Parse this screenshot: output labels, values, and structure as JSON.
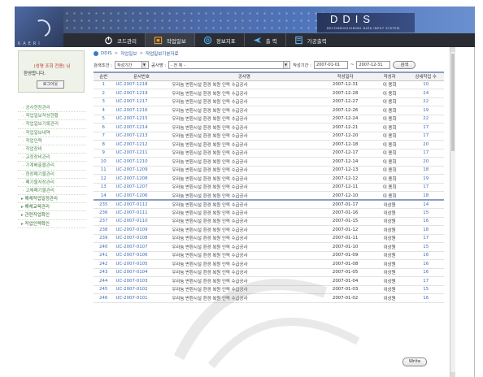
{
  "header": {
    "brand_title": "DDIS",
    "brand_sub": "DECOMMISSIONING DATA INPUT SYSTEM",
    "logo_text": "KAERI",
    "nav": [
      {
        "label": "코드관리",
        "icon": "power-icon"
      },
      {
        "label": "작업일보",
        "icon": "calendar-icon",
        "active": true
      },
      {
        "label": "정보지표",
        "icon": "at-icon"
      },
      {
        "label": "출 력",
        "icon": "plane-icon"
      },
      {
        "label": "가공출력",
        "icon": "document-icon"
      }
    ]
  },
  "left": {
    "greet_line1": "(성명 조회 전용) 님",
    "greet_line2": "환영합니다.",
    "logout_label": "로그아웃",
    "menu": [
      {
        "label": "공사현장관리",
        "type": "sub"
      },
      {
        "label": "작업일보작성현황",
        "type": "sub"
      },
      {
        "label": "작업일보기록관리",
        "type": "sub"
      },
      {
        "label": "작업일보내역",
        "type": "sub"
      },
      {
        "label": "작업인력",
        "type": "sub"
      },
      {
        "label": "작업장비",
        "type": "sub"
      },
      {
        "label": "교정장비관리",
        "type": "sub"
      },
      {
        "label": "기계배출물관리",
        "type": "sub"
      },
      {
        "label": "현장폐기물관리",
        "type": "sub"
      },
      {
        "label": "폐기물저장관리",
        "type": "sub"
      },
      {
        "label": "고체폐기물관리",
        "type": "sub"
      },
      {
        "label": "해체작업일정관리",
        "type": "top"
      },
      {
        "label": "해체교육관리",
        "type": "top"
      },
      {
        "label": "관련작업확인",
        "type": "top"
      },
      {
        "label": "작업인력확인",
        "type": "top"
      }
    ]
  },
  "breadcrumb": [
    "DDIS",
    "작업일보",
    "작업일보기본자료"
  ],
  "search": {
    "cond_label": "검색조건 :",
    "cond_value": "작성기간",
    "proj_label": "공사명 :",
    "proj_value": "- 전 체 -",
    "period_label": "작성기간 :",
    "date_from": "2007-01-01",
    "date_to": "2007-12-31",
    "button": "검색"
  },
  "table": {
    "headers": [
      "순번",
      "문서번호",
      "공사명",
      "작성일자",
      "작성자",
      "상세작업 수"
    ],
    "rows": [
      [
        "1",
        "UC-2007-1218",
        "우라늄 변환시설 환경 복원 인력 수급공사",
        "2007-12-31",
        "이 용희",
        "10"
      ],
      [
        "2",
        "UC-2007-1219",
        "우라늄 변환시설 환경 복원 인력 수급공사",
        "2007-12-28",
        "이 용희",
        "24"
      ],
      [
        "3",
        "UC-2007-1217",
        "우라늄 변환시설 환경 복원 인력 수급공사",
        "2007-12-27",
        "이 용희",
        "22"
      ],
      [
        "4",
        "UC-2007-1216",
        "우라늄 변환시설 환경 복원 인력 수급공사",
        "2007-12-26",
        "이 용희",
        "19"
      ],
      [
        "5",
        "UC-2007-1215",
        "우라늄 변환시설 환경 복원 인력 수급공사",
        "2007-12-24",
        "이 용희",
        "22"
      ],
      [
        "6",
        "UC-2007-1214",
        "우라늄 변환시설 환경 복원 인력 수급공사",
        "2007-12-21",
        "이 용희",
        "17"
      ],
      [
        "7",
        "UC-2007-1213",
        "우라늄 변환시설 환경 복원 인력 수급공사",
        "2007-12-20",
        "이 용희",
        "17"
      ],
      [
        "8",
        "UC-2007-1212",
        "우라늄 변환시설 환경 복원 인력 수급공사",
        "2007-12-18",
        "이 용희",
        "20"
      ],
      [
        "9",
        "UC-2007-1211",
        "우라늄 변환시설 환경 복원 인력 수급공사",
        "2007-12-17",
        "이 용희",
        "17"
      ],
      [
        "10",
        "UC-2007-1210",
        "우라늄 변환시설 환경 복원 인력 수급공사",
        "2007-12-14",
        "이 용희",
        "20"
      ],
      [
        "11",
        "UC-2007-1209",
        "우라늄 변환시설 환경 복원 인력 수급공사",
        "2007-12-13",
        "이 용희",
        "18"
      ],
      [
        "12",
        "UC-2007-1208",
        "우라늄 변환시설 환경 복원 인력 수급공사",
        "2007-12-12",
        "이 용희",
        "19"
      ],
      [
        "13",
        "UC-2007-1207",
        "우라늄 변환시설 환경 복원 인력 수급공사",
        "2007-12-11",
        "이 용희",
        "17"
      ],
      [
        "14",
        "UC-2007-1206",
        "우라늄 변환시설 환경 복원 인력 수급공사",
        "2007-12-10",
        "이 용희",
        "18"
      ]
    ],
    "rows2": [
      [
        "235",
        "UC-2007-0112",
        "우라늄 변환시설 환경 복원 인력 수급공사",
        "2007-01-17",
        "이상원",
        "14"
      ],
      [
        "236",
        "UC-2007-0111",
        "우라늄 변환시설 환경 복원 인력 수급공사",
        "2007-01-16",
        "이상원",
        "15"
      ],
      [
        "237",
        "UC-2007-0110",
        "우라늄 변환시설 환경 복원 인력 수급공사",
        "2007-01-15",
        "이상원",
        "16"
      ],
      [
        "238",
        "UC-2007-0109",
        "우라늄 변환시설 환경 복원 인력 수급공사",
        "2007-01-12",
        "이상원",
        "18"
      ],
      [
        "239",
        "UC-2007-0108",
        "우라늄 변환시설 환경 복원 인력 수급공사",
        "2007-01-11",
        "이상원",
        "17"
      ],
      [
        "240",
        "UC-2007-0107",
        "우라늄 변환시설 환경 복원 인력 수급공사",
        "2007-01-10",
        "이상원",
        "15"
      ],
      [
        "241",
        "UC-2007-0106",
        "우라늄 변환시설 환경 복원 인력 수급공사",
        "2007-01-09",
        "이상원",
        "16"
      ],
      [
        "242",
        "UC-2007-0105",
        "우라늄 변환시설 환경 복원 인력 수급공사",
        "2007-01-08",
        "이상원",
        "16"
      ],
      [
        "243",
        "UC-2007-0104",
        "우라늄 변환시설 환경 복원 인력 수급공사",
        "2007-01-05",
        "이상원",
        "16"
      ],
      [
        "244",
        "UC-2007-0103",
        "우라늄 변환시설 환경 복원 인력 수급공사",
        "2007-01-04",
        "이상원",
        "17"
      ],
      [
        "245",
        "UC-2007-0102",
        "우라늄 변환시설 환경 복원 인력 수급공사",
        "2007-01-03",
        "이상원",
        "15"
      ],
      [
        "246",
        "UC-2007-0101",
        "우라늄 변환시설 환경 복원 인력 수급공사",
        "2007-01-02",
        "이상원",
        "16"
      ]
    ]
  },
  "write_label": "Write"
}
